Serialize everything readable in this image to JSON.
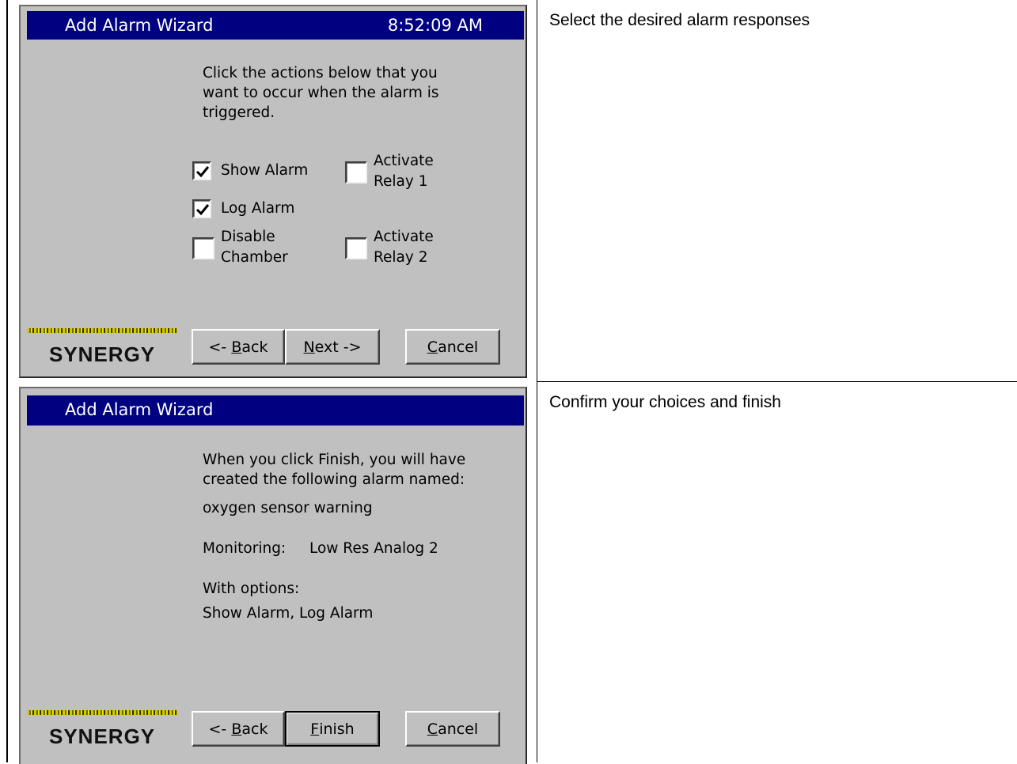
{
  "panels": [
    {
      "title": "Add Alarm Wizard",
      "clock": "8:52:09 AM",
      "instructions": [
        "Click the actions below that you",
        "want to occur when the alarm is",
        "triggered."
      ],
      "checkboxes": {
        "show_alarm": {
          "label": "Show Alarm",
          "checked": true
        },
        "log_alarm": {
          "label": "Log Alarm",
          "checked": true
        },
        "disable_chamber": {
          "label1": "Disable",
          "label2": "Chamber",
          "checked": false
        },
        "activate_relay_1": {
          "label1": "Activate",
          "label2": "Relay 1",
          "checked": false
        },
        "activate_relay_2": {
          "label1": "Activate",
          "label2": "Relay 2",
          "checked": false
        }
      },
      "buttons": {
        "back": {
          "pre": "<- ",
          "u": "B",
          "post": "ack"
        },
        "next": {
          "pre": "",
          "u": "N",
          "post": "ext ->"
        },
        "cancel": {
          "pre": "",
          "u": "C",
          "post": "ancel"
        }
      },
      "logo": "SYNERGY",
      "caption": "Select the desired alarm responses"
    },
    {
      "title": "Add Alarm Wizard",
      "summary": [
        "When you click Finish, you will have",
        "created the following alarm named:"
      ],
      "alarm_name": "oxygen sensor warning",
      "monitoring_label": "Monitoring:",
      "monitoring_value": "Low Res Analog 2",
      "options_label": "With options:",
      "options_value": "Show Alarm, Log Alarm",
      "buttons": {
        "back": {
          "pre": "<- ",
          "u": "B",
          "post": "ack"
        },
        "finish": {
          "pre": "",
          "u": "F",
          "post": "inish"
        },
        "cancel": {
          "pre": "",
          "u": "C",
          "post": "ancel"
        }
      },
      "logo": "SYNERGY",
      "caption": "Confirm your choices and finish"
    }
  ],
  "colors": {
    "titlebar": "#000080",
    "dialog_bg": "#c0c0c0",
    "logo_stripe": "#d8c400"
  },
  "icons": [
    "checkmark-icon"
  ]
}
